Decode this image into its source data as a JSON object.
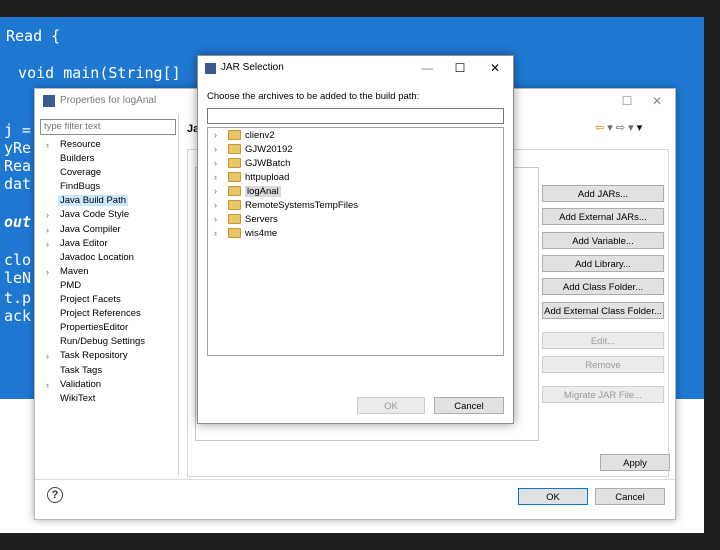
{
  "background": {
    "code_lines": [
      "Read {",
      "  void main(String[]",
      "j =",
      "yRe",
      "Rea",
      "dat",
      "out",
      "clo",
      "leN",
      "t.p",
      "ack"
    ]
  },
  "properties_window": {
    "title": "Properties for logAnal",
    "filter_placeholder": "type filter text",
    "tree_items": [
      {
        "label": "Resource",
        "expandable": true
      },
      {
        "label": "Builders",
        "expandable": false
      },
      {
        "label": "Coverage",
        "expandable": false
      },
      {
        "label": "FindBugs",
        "expandable": false
      },
      {
        "label": "Java Build Path",
        "expandable": false,
        "selected": true
      },
      {
        "label": "Java Code Style",
        "expandable": true
      },
      {
        "label": "Java Compiler",
        "expandable": true
      },
      {
        "label": "Java Editor",
        "expandable": true
      },
      {
        "label": "Javadoc Location",
        "expandable": false
      },
      {
        "label": "Maven",
        "expandable": true
      },
      {
        "label": "PMD",
        "expandable": false
      },
      {
        "label": "Project Facets",
        "expandable": false
      },
      {
        "label": "Project References",
        "expandable": false
      },
      {
        "label": "PropertiesEditor",
        "expandable": false
      },
      {
        "label": "Run/Debug Settings",
        "expandable": false
      },
      {
        "label": "Task Repository",
        "expandable": true
      },
      {
        "label": "Task Tags",
        "expandable": false
      },
      {
        "label": "Validation",
        "expandable": true
      },
      {
        "label": "WikiText",
        "expandable": false
      }
    ],
    "right_title": "Ja",
    "buttons": [
      {
        "label": "Add JARs...",
        "enabled": true
      },
      {
        "label": "Add External JARs...",
        "enabled": true
      },
      {
        "label": "Add Variable...",
        "enabled": true
      },
      {
        "label": "Add Library...",
        "enabled": true
      },
      {
        "label": "Add Class Folder...",
        "enabled": true
      },
      {
        "label": "Add External Class Folder...",
        "enabled": true
      },
      {
        "label": "Edit...",
        "enabled": false
      },
      {
        "label": "Remove",
        "enabled": false
      },
      {
        "label": "Migrate JAR File...",
        "enabled": false
      }
    ],
    "apply_label": "Apply",
    "ok_label": "OK",
    "cancel_label": "Cancel",
    "help_glyph": "?"
  },
  "jar_dialog": {
    "title": "JAR Selection",
    "description": "Choose the archives to be added to the build path:",
    "filter_value": "",
    "items": [
      {
        "label": "clienv2",
        "selected": false
      },
      {
        "label": "GJW20192",
        "selected": false
      },
      {
        "label": "GJWBatch",
        "selected": false
      },
      {
        "label": "httpupload",
        "selected": false
      },
      {
        "label": "logAnal",
        "selected": true
      },
      {
        "label": "RemoteSystemsTempFiles",
        "selected": false
      },
      {
        "label": "Servers",
        "selected": false
      },
      {
        "label": "wis4me",
        "selected": false
      }
    ],
    "ok_label": "OK",
    "cancel_label": "Cancel"
  },
  "glyphs": {
    "minimize": "—",
    "maximize": "☐",
    "close": "✕",
    "expand_arrow": "›",
    "nav_back": "⇦",
    "nav_forward": "⇨",
    "dropdown": "▾"
  },
  "colors": {
    "editor_bg": "#1e78d2",
    "selection": "#cce8ff",
    "dialog_bg": "#ffffff"
  }
}
